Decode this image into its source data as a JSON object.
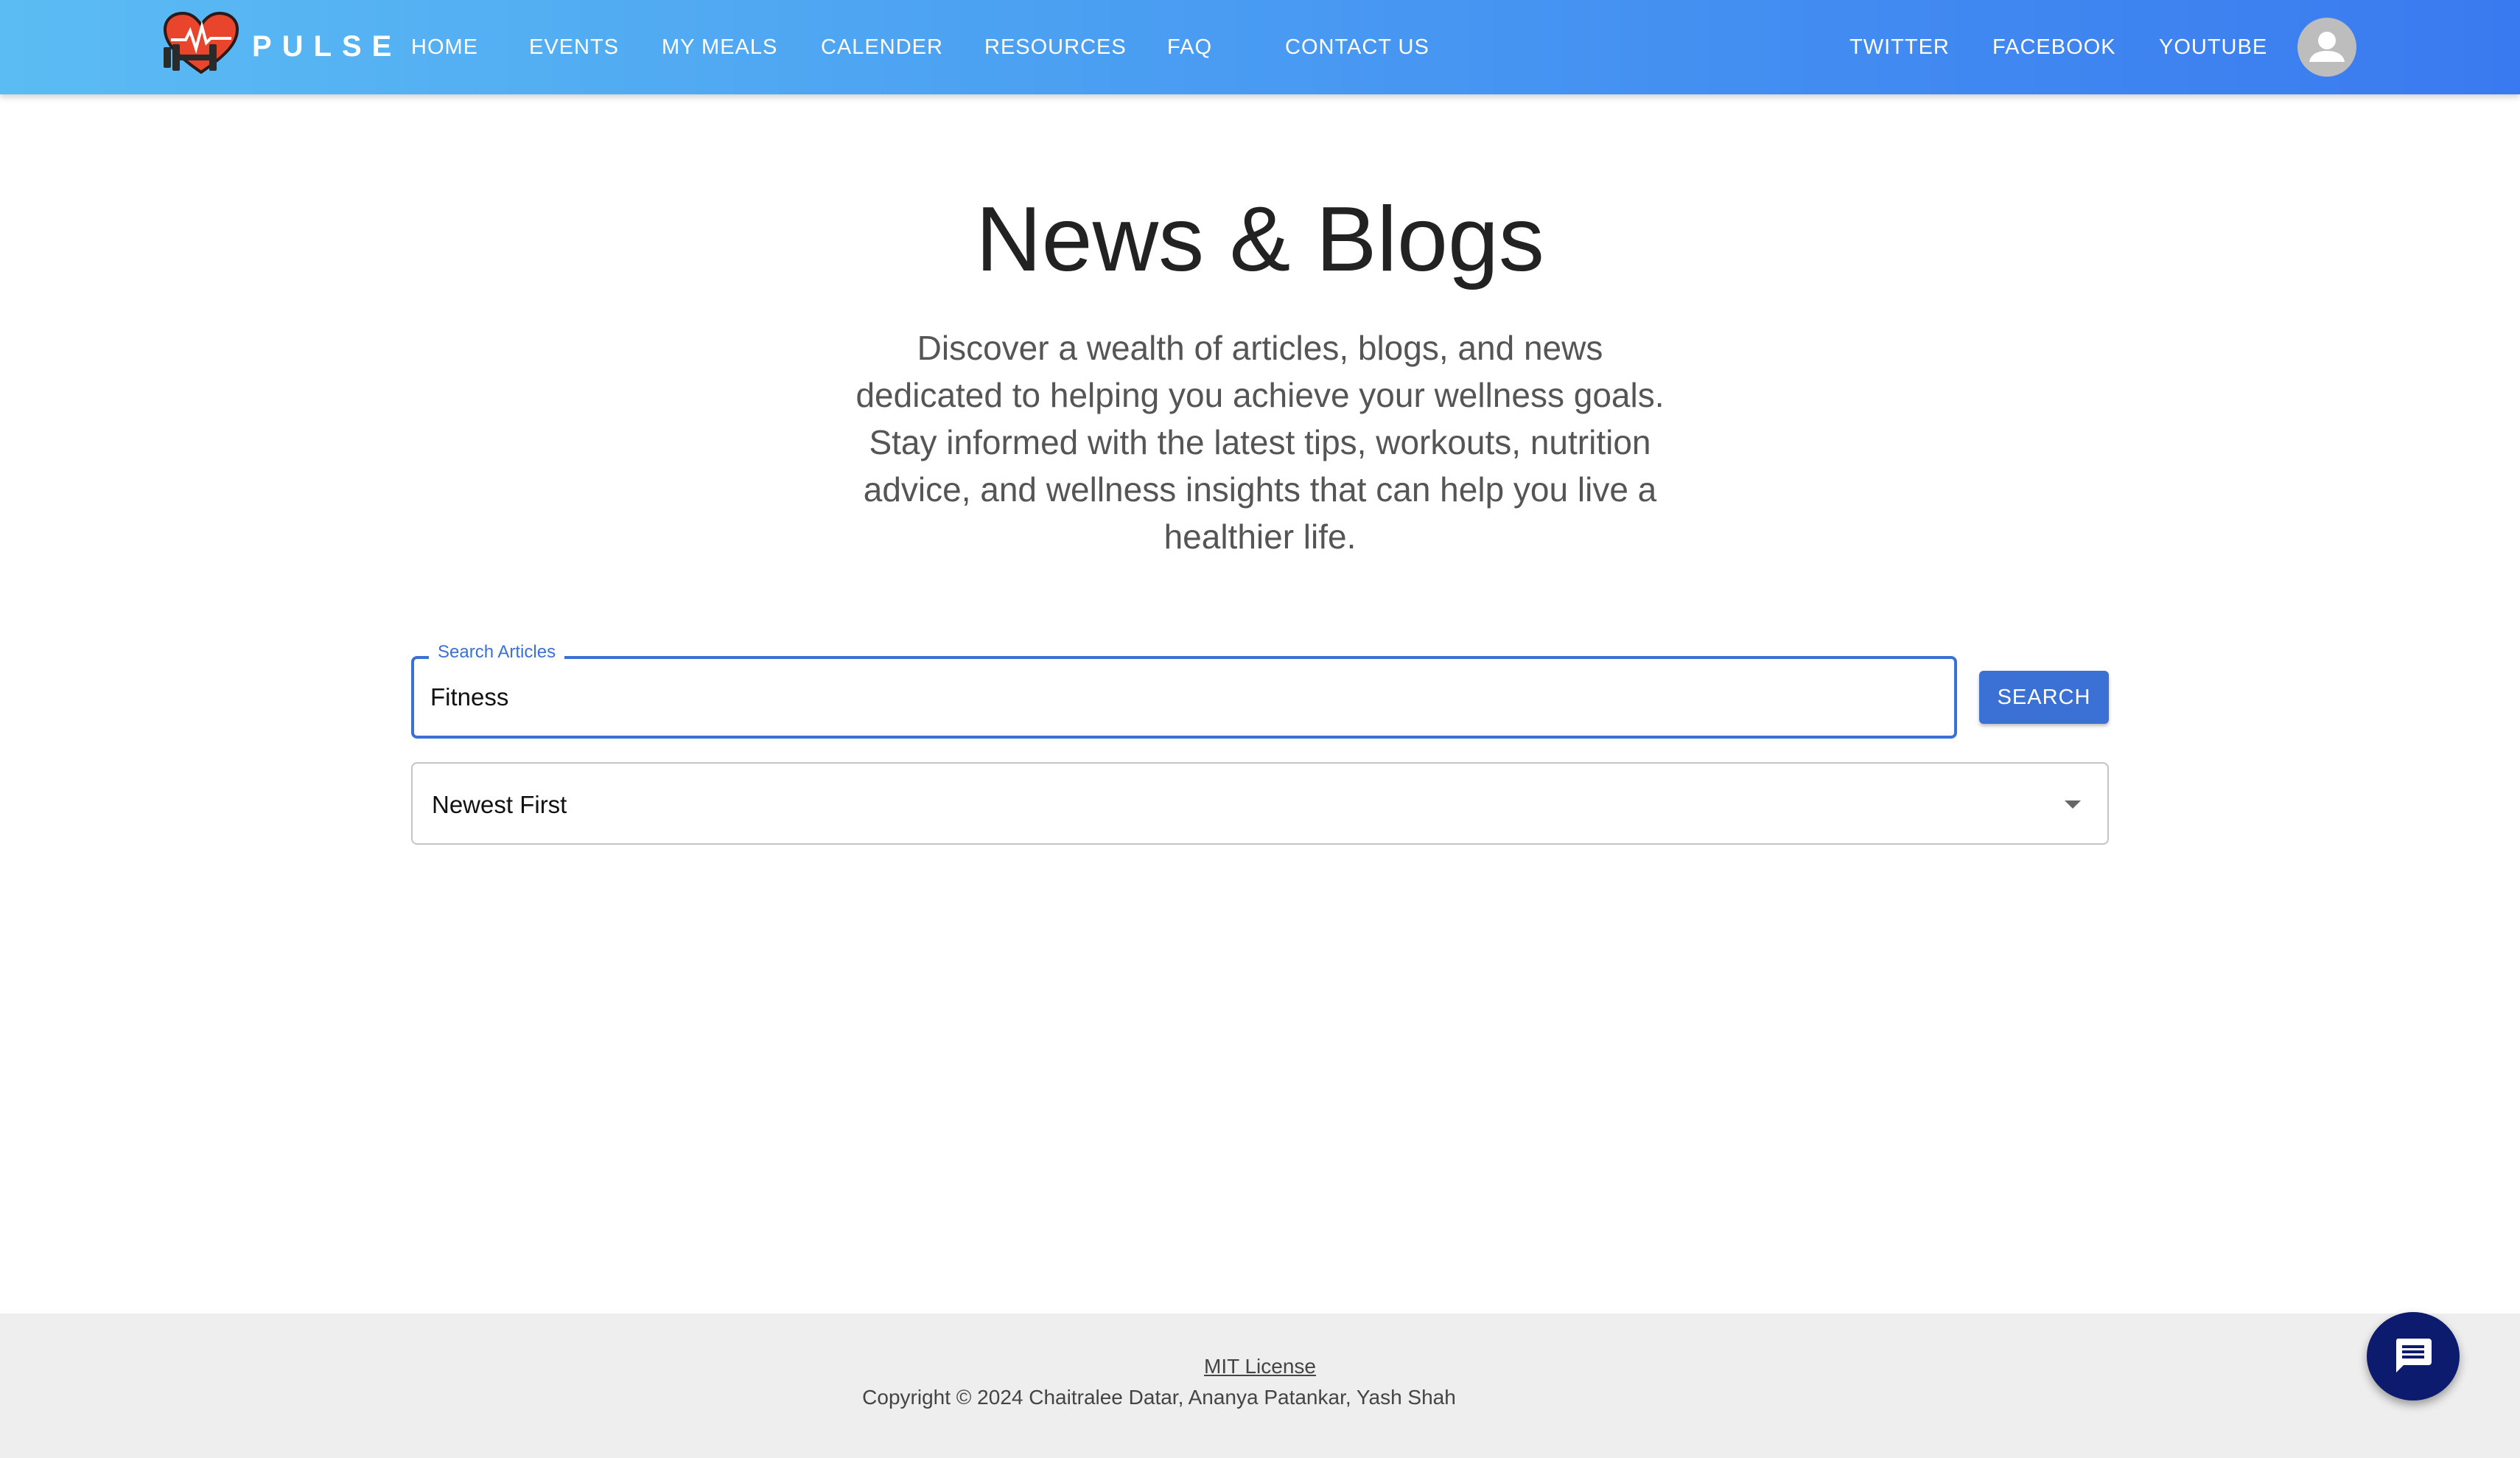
{
  "header": {
    "brand": "PULSE",
    "nav": [
      {
        "label": "HOME"
      },
      {
        "label": "EVENTS"
      },
      {
        "label": "MY MEALS"
      },
      {
        "label": "CALENDER"
      },
      {
        "label": "RESOURCES"
      },
      {
        "label": "FAQ"
      },
      {
        "label": "CONTACT US"
      }
    ],
    "social": [
      {
        "label": "TWITTER"
      },
      {
        "label": "FACEBOOK"
      },
      {
        "label": "YOUTUBE"
      }
    ],
    "avatar_icon": "user-icon"
  },
  "main": {
    "title": "News & Blogs",
    "description": "Discover a wealth of articles, blogs, and news dedicated to helping you achieve your wellness goals. Stay informed with the latest tips, workouts, nutrition advice, and wellness insights that can help you live a healthier life.",
    "search": {
      "label": "Search Articles",
      "value": "Fitness",
      "button_label": "SEARCH"
    },
    "sort": {
      "selected": "Newest First"
    }
  },
  "footer": {
    "license": "MIT License",
    "copyright": "Copyright © 2024 Chaitralee Datar, Ananya Patankar, Yash Shah"
  },
  "chat": {
    "icon": "chat-icon"
  },
  "colors": {
    "header_start": "#5bbcf3",
    "header_end": "#3a7af0",
    "accent": "#3b71d4",
    "chat_fab": "#0d1b6e"
  }
}
